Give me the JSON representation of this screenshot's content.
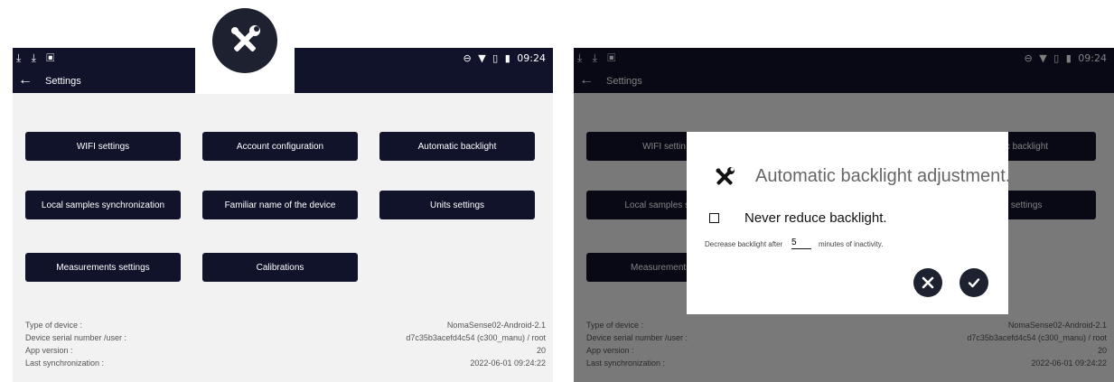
{
  "status": {
    "left_icons": "⤓ ⤓ ▣",
    "right_icons": [
      "⊖",
      "▼",
      "▯",
      "▮"
    ],
    "time": "09:24"
  },
  "header": {
    "back": "←",
    "title": "Settings"
  },
  "buttons": [
    "WIFI settings",
    "Account configuration",
    "Automatic backlight",
    "Local samples synchronization",
    "Familiar name of the device",
    "Units settings",
    "Measurements settings",
    "Calibrations"
  ],
  "right_buttons": {
    "wifi": "WIFI settin",
    "backlight": "matic backlight",
    "local": "Local samples sync",
    "units": "nits settings",
    "measurements": "Measurements s"
  },
  "info": {
    "labels": [
      "Type of device :",
      "Device serial number /user :",
      "App version :",
      "Last synchronization :"
    ],
    "values": [
      "NomaSense02-Android-2.1",
      "d7c35b3acefd4c54 (c300_manu) / root",
      "20",
      "2022-06-01 09:24:22"
    ]
  },
  "dialog": {
    "title": "Automatic backlight adjustment.",
    "checkbox_label": "Never reduce backlight.",
    "decrease_prefix": "Decrease backlight after",
    "input_value": "5",
    "decrease_suffix": "minutes of inactivity."
  }
}
